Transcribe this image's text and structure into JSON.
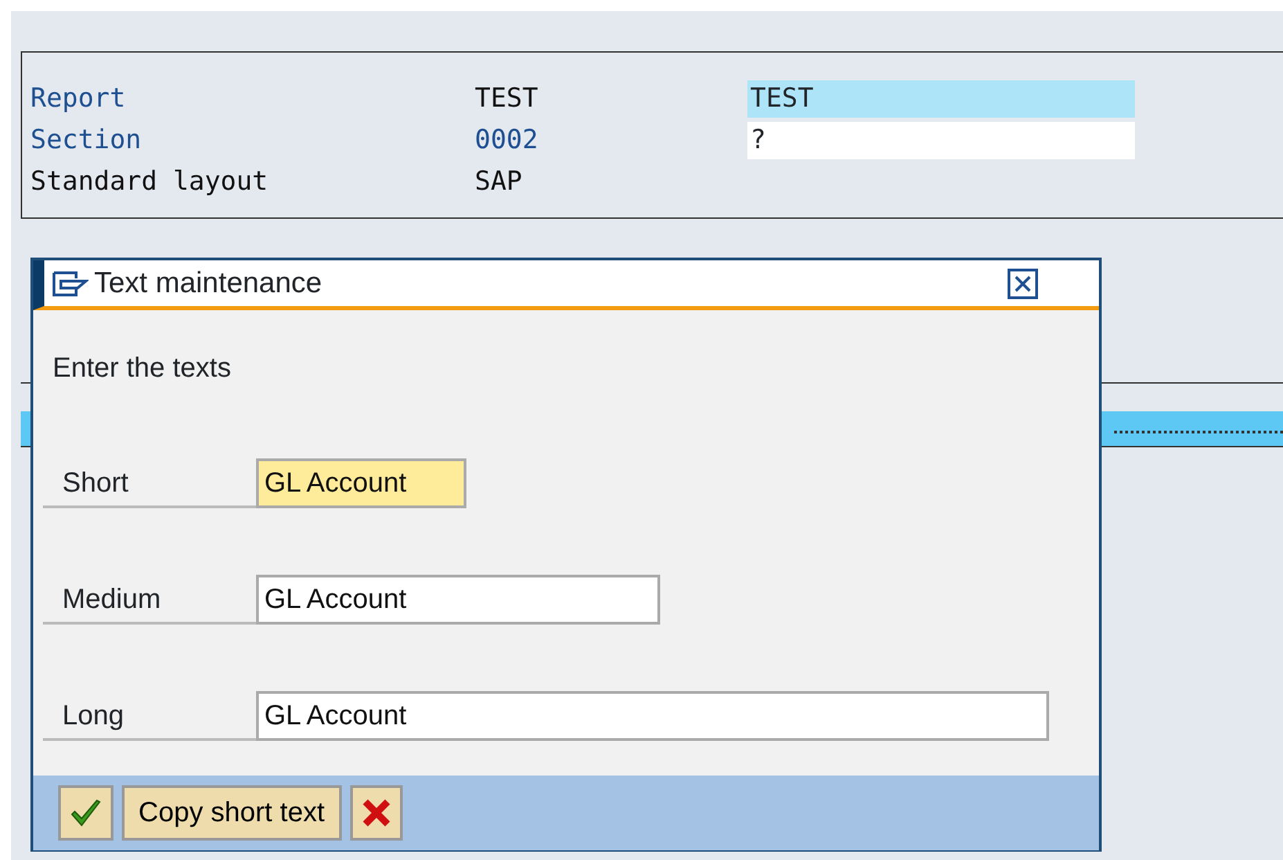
{
  "header_rows": [
    {
      "label": {
        "text": "Report",
        "kind": "key"
      },
      "value": {
        "text": "TEST",
        "kind": "plain"
      },
      "field": {
        "value": "TEST",
        "selected": true
      }
    },
    {
      "label": {
        "text": "Section",
        "kind": "key"
      },
      "value": {
        "text": "0002",
        "kind": "key"
      },
      "field": {
        "value": "?",
        "selected": false
      }
    },
    {
      "label": {
        "text": "Standard layout",
        "kind": "plain"
      },
      "value": {
        "text": "SAP",
        "kind": "plain"
      }
    }
  ],
  "dialog": {
    "title": "Text maintenance",
    "prompt": "Enter the texts",
    "fields": [
      {
        "label": "Short",
        "value": "GL Account",
        "focused": true
      },
      {
        "label": "Medium",
        "value": "GL Account",
        "focused": false
      },
      {
        "label": "Long",
        "value": "GL Account",
        "focused": false
      }
    ],
    "buttons": [
      {
        "kind": "confirm"
      },
      {
        "kind": "text",
        "label": "Copy short text"
      },
      {
        "kind": "cancel"
      }
    ]
  }
}
